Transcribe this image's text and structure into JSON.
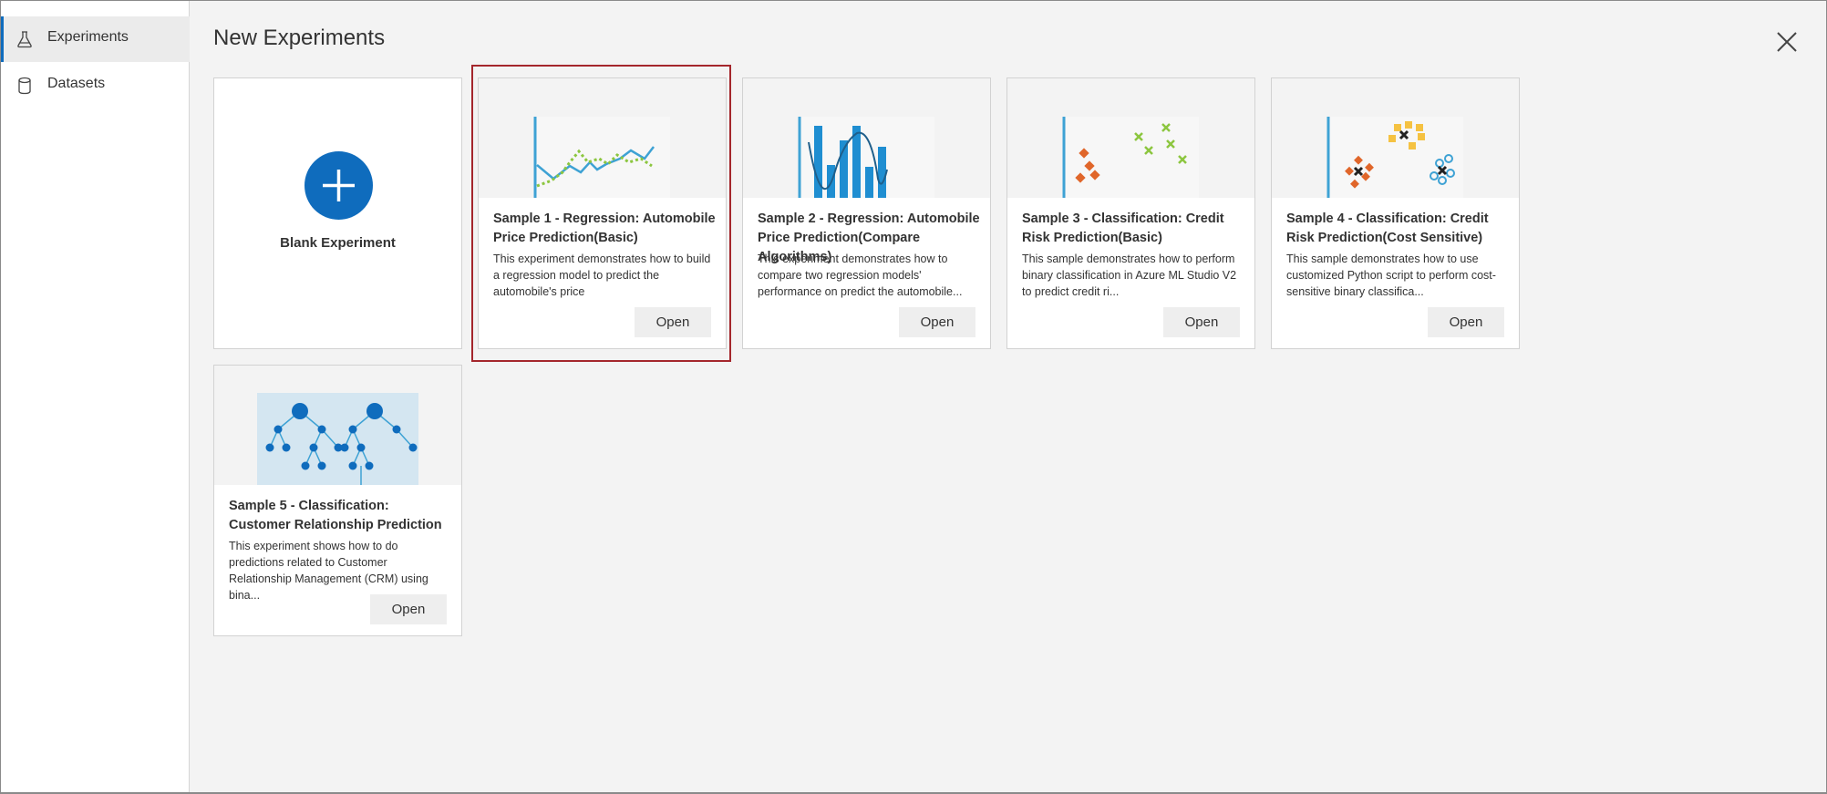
{
  "sidebar": {
    "items": [
      {
        "label": "Experiments",
        "icon": "beaker-icon",
        "active": true
      },
      {
        "label": "Datasets",
        "icon": "database-icon",
        "active": false
      }
    ]
  },
  "header": {
    "title": "New Experiments",
    "close_icon": "close-icon"
  },
  "blank_card": {
    "label": "Blank Experiment",
    "icon": "plus-icon"
  },
  "samples": [
    {
      "title": "Sample 1 - Regression: Automobile Price Prediction(Basic)",
      "description": "This experiment demonstrates how to build a regression model to predict the automobile's price",
      "open_label": "Open",
      "selected": true
    },
    {
      "title": "Sample 2 - Regression: Automobile Price Prediction(Compare Algorithms)",
      "description": "This experiment demonstrates how to compare two regression models' performance on predict the automobile...",
      "open_label": "Open",
      "selected": false
    },
    {
      "title": "Sample 3 - Classification: Credit Risk Prediction(Basic)",
      "description": "This sample demonstrates how to perform binary classification in Azure ML Studio V2 to predict credit ri...",
      "open_label": "Open",
      "selected": false
    },
    {
      "title": "Sample 4 - Classification: Credit Risk Prediction(Cost Sensitive)",
      "description": "This sample demonstrates how to use customized Python script to perform cost-sensitive binary classifica...",
      "open_label": "Open",
      "selected": false
    },
    {
      "title": "Sample 5 - Classification: Customer Relationship Prediction",
      "description": "This experiment shows how to do predictions related to Customer Relationship Management (CRM) using bina...",
      "open_label": "Open",
      "selected": false
    }
  ],
  "colors": {
    "accent": "#0f6cbd",
    "selected_border": "#a4262c",
    "green": "#8cc63f",
    "orange": "#e0662a",
    "yellow": "#f5c242",
    "light_blue": "#3ea2d4"
  }
}
